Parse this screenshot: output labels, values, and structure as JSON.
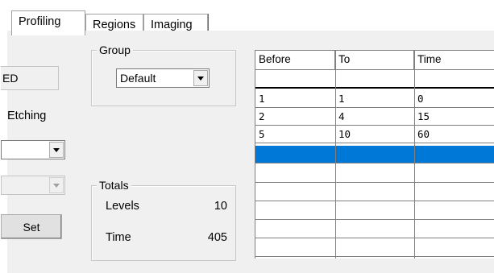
{
  "tabs": [
    {
      "label": "Profiling",
      "active": true
    },
    {
      "label": "Regions",
      "active": false
    },
    {
      "label": "Imaging",
      "active": false
    }
  ],
  "left": {
    "edge_field_value": "ED",
    "etching_label": "Etching",
    "set_button": "Set"
  },
  "group": {
    "title": "Group",
    "selected": "Default"
  },
  "totals": {
    "title": "Totals",
    "levels_label": "Levels",
    "levels_value": "10",
    "time_label": "Time",
    "time_value": "405"
  },
  "grid": {
    "columns": [
      "Before",
      "To",
      "Time"
    ],
    "rows": [
      [
        "1",
        "1",
        "0"
      ],
      [
        "2",
        "4",
        "15"
      ],
      [
        "5",
        "10",
        "60"
      ]
    ],
    "selected_row_color": "#0078d7"
  }
}
